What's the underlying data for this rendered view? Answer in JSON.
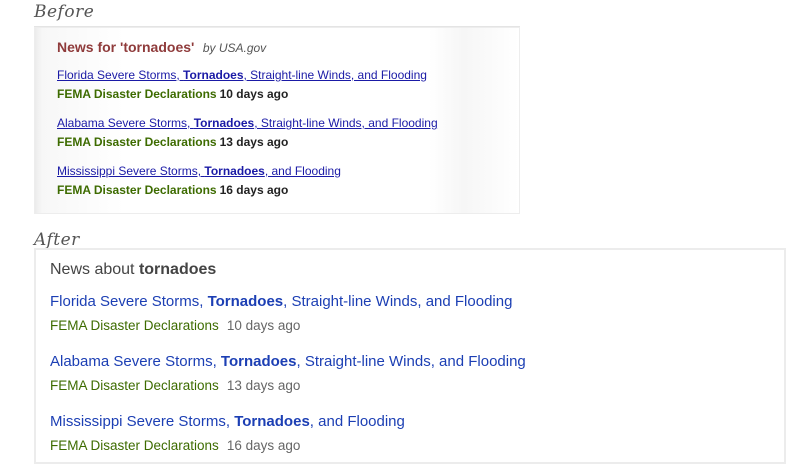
{
  "labels": {
    "before": "Before",
    "after": "After"
  },
  "before": {
    "title": "News for 'tornadoes'",
    "byline": "by USA.gov",
    "items": [
      {
        "link_pre": "Florida Severe Storms, ",
        "link_bold": "Tornadoes",
        "link_post": ", Straight-line Winds, and Flooding",
        "source": "FEMA Disaster Declarations",
        "age": "10 days ago"
      },
      {
        "link_pre": "Alabama Severe Storms, ",
        "link_bold": "Tornadoes",
        "link_post": ", Straight-line Winds, and Flooding",
        "source": "FEMA Disaster Declarations",
        "age": "13 days ago"
      },
      {
        "link_pre": "Mississippi Severe Storms, ",
        "link_bold": "Tornadoes",
        "link_post": ", and Flooding",
        "source": "FEMA Disaster Declarations",
        "age": "16 days ago"
      }
    ]
  },
  "after": {
    "title_prefix": "News about ",
    "title_term": "tornadoes",
    "items": [
      {
        "link_pre": "Florida Severe Storms, ",
        "link_bold": "Tornadoes",
        "link_post": ", Straight-line Winds, and Flooding",
        "source": "FEMA Disaster Declarations",
        "age": "10 days ago"
      },
      {
        "link_pre": "Alabama Severe Storms, ",
        "link_bold": "Tornadoes",
        "link_post": ", Straight-line Winds, and Flooding",
        "source": "FEMA Disaster Declarations",
        "age": "13 days ago"
      },
      {
        "link_pre": "Mississippi Severe Storms, ",
        "link_bold": "Tornadoes",
        "link_post": ", and Flooding",
        "source": "FEMA Disaster Declarations",
        "age": "16 days ago"
      }
    ]
  }
}
